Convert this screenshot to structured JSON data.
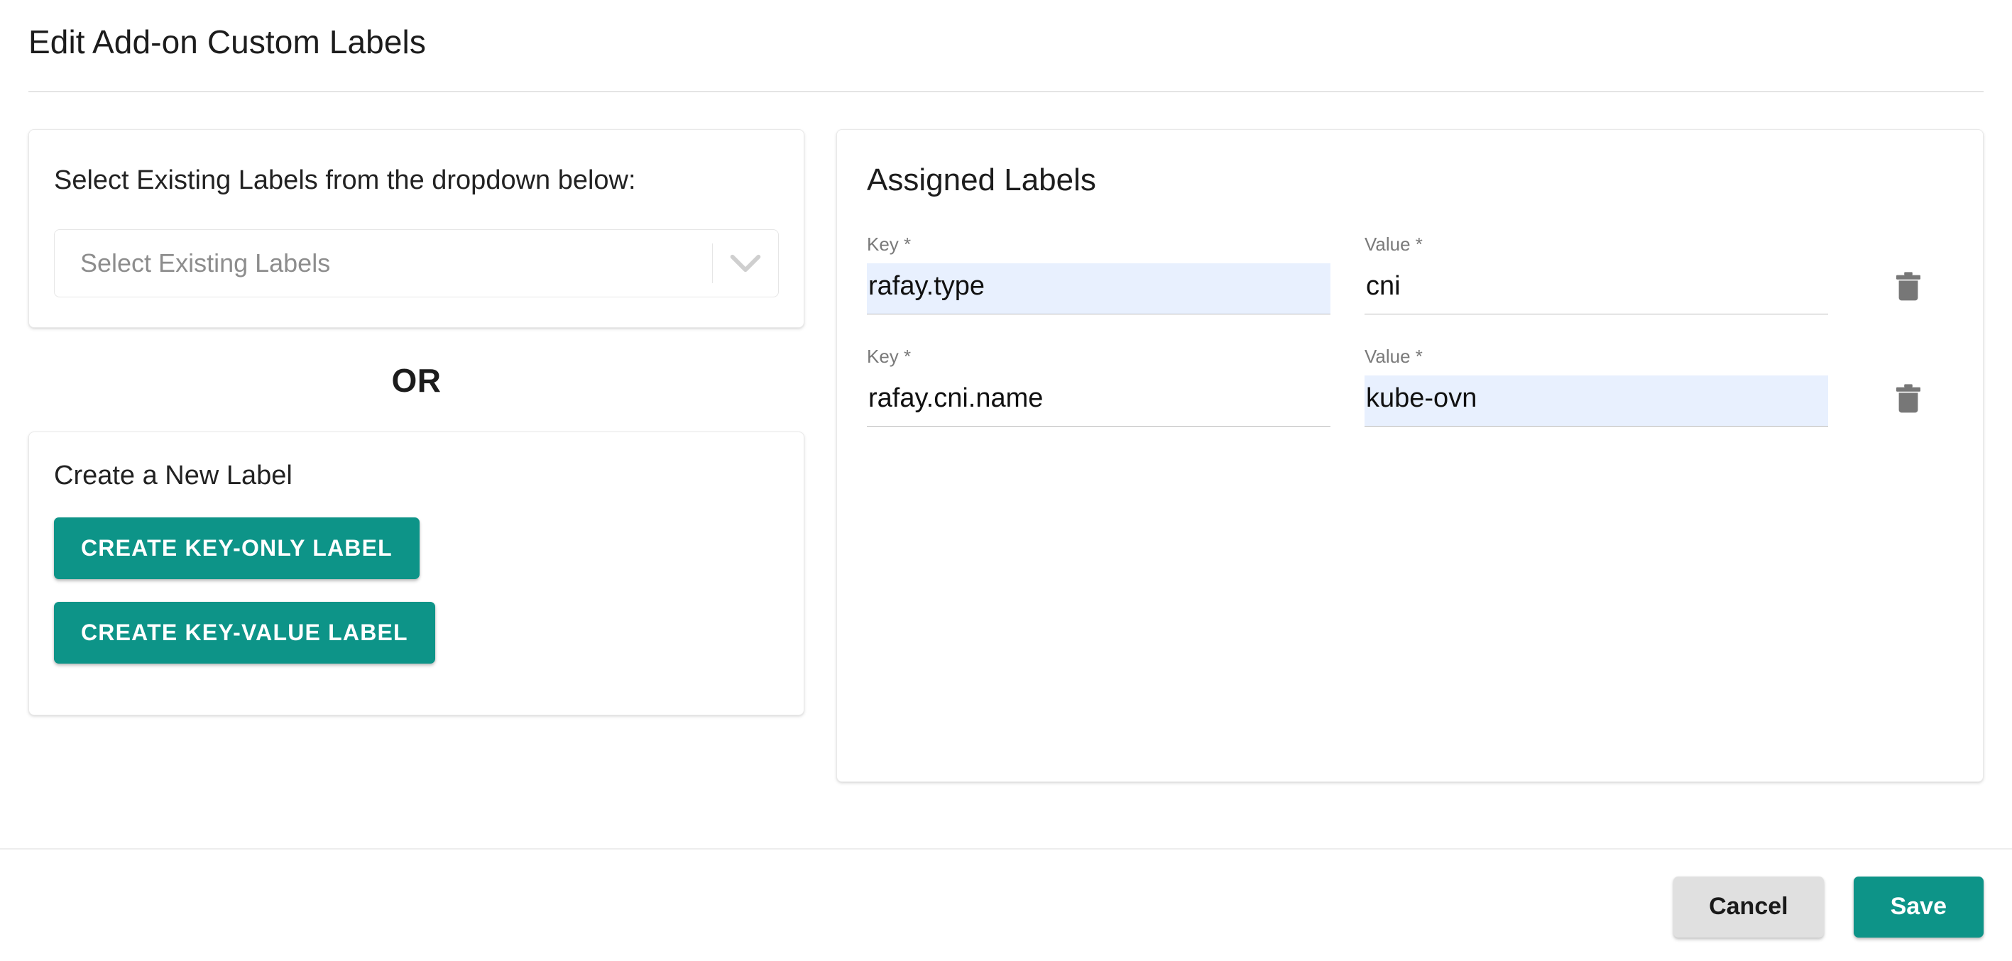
{
  "header": {
    "title": "Edit Add-on Custom Labels"
  },
  "left_panel": {
    "select_card": {
      "instruction": "Select Existing Labels from the dropdown below:",
      "dropdown": {
        "placeholder": "Select Existing Labels",
        "value": "",
        "arrow_icon": "chevron-down-icon"
      }
    },
    "divider_text": "OR",
    "create_card": {
      "title": "Create a New Label",
      "key_only_button": "CREATE KEY-ONLY LABEL",
      "key_value_button": "CREATE KEY-VALUE LABEL"
    }
  },
  "right_panel": {
    "title": "Assigned Labels",
    "key_label": "Key *",
    "value_label": "Value *",
    "delete_icon": "trash-icon",
    "rows": [
      {
        "key": "rafay.type",
        "value": "cni",
        "key_highlighted": true,
        "value_highlighted": false
      },
      {
        "key": "rafay.cni.name",
        "value": "kube-ovn",
        "key_highlighted": false,
        "value_highlighted": true
      }
    ]
  },
  "footer": {
    "cancel_label": "Cancel",
    "save_label": "Save"
  },
  "colors": {
    "accent_teal": "#0d9488",
    "cancel_gray": "#e0e0e0",
    "autofill_blue": "#e8f0fe",
    "text_primary": "#1c1c1c",
    "text_muted": "#7a7a7a",
    "border": "#e6e6e6"
  }
}
